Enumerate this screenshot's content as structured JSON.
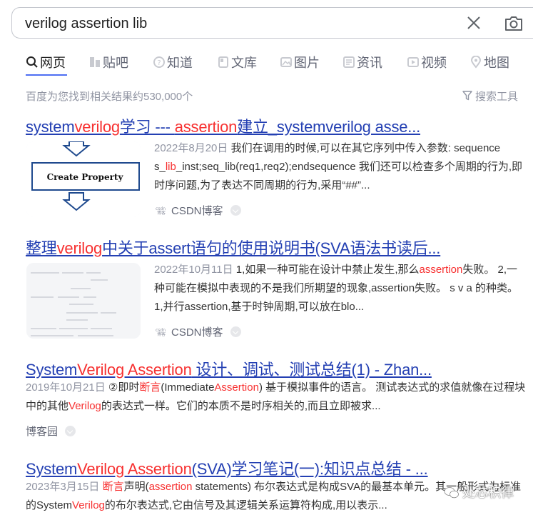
{
  "search": {
    "value": "verilog assertion lib"
  },
  "tabs": [
    {
      "label": "网页",
      "icon": "search-icon"
    },
    {
      "label": "贴吧",
      "icon": "tieba-icon"
    },
    {
      "label": "知道",
      "icon": "zhidao-icon"
    },
    {
      "label": "文库",
      "icon": "wenku-icon"
    },
    {
      "label": "图片",
      "icon": "image-icon"
    },
    {
      "label": "资讯",
      "icon": "news-icon"
    },
    {
      "label": "视频",
      "icon": "video-icon"
    },
    {
      "label": "地图",
      "icon": "map-icon"
    }
  ],
  "result_count": "百度为您找到相关结果约530,000个",
  "tools_label": "搜索工具",
  "results": [
    {
      "title": {
        "p1": "system",
        "e1": "verilog",
        "p2": "学习 --- ",
        "e2": "assertion",
        "p3": "建立_systemverilog asse..."
      },
      "date": "2022年8月20日",
      "abstract": {
        "a1": " 我们在调用的时候,可以在其它序列中传入参数: sequence s_",
        "e1": "lib",
        "a2": "_inst;seq_lib(req1,req2);endsequence 我们还可以检查多个周期的行为,即时序问题,为了表达不同周期的行为,采用“##”..."
      },
      "thumb_text": "Create Property",
      "source": "CSDN博客"
    },
    {
      "title": {
        "p1": "整理",
        "e1": "verilog",
        "p2": "中关于assert语句的使用说明书(SVA语法书读后..."
      },
      "date": "2022年10月11日",
      "abstract": {
        "a1": " 1,如果一种可能在设计中禁止发生,那么",
        "e1": "assertion",
        "a2": "失败。 2,一种可能在模拟中表现的不是我们所期望的现象,assertion失败。 s v a 的种类。 1,并行assertion,基于时钟周期,可以放在blo..."
      },
      "source": "CSDN博客"
    },
    {
      "title": {
        "p1": "System",
        "e1": "Verilog Assertion",
        "p2": " 设计、调试、测试总结(1) - Zhan..."
      },
      "date": "2019年10月21日",
      "abstract": {
        "a1": " ②即时",
        "e1": "断言",
        "a2": "(Immediate",
        "e2": "Assertion",
        "a3": ") 基于模拟事件的语言。 测试表达式的求值就像在过程块中的其他",
        "e3": "Verilog",
        "a4": "的表达式一样。它们的本质不是时序相关的,而且立即被求..."
      },
      "source": "博客园"
    },
    {
      "title": {
        "p1": "System",
        "e1": "Verilog Assertion",
        "p2": "(SVA)学习笔记(一):知识点总结 - ..."
      },
      "date": "2023年3月15日",
      "abstract": {
        "a1": " ",
        "e1": "断言",
        "a2": "声明(",
        "e2": "assertion",
        "a3": " statements) 布尔表达式是构成SVA的最基本单元。其一般形式为标准的System",
        "e3": "Verilog",
        "a4": "的布尔表达式,它由信号及其逻辑关系运算符构成,用以表示..."
      }
    }
  ],
  "watermark": "处芯积律"
}
